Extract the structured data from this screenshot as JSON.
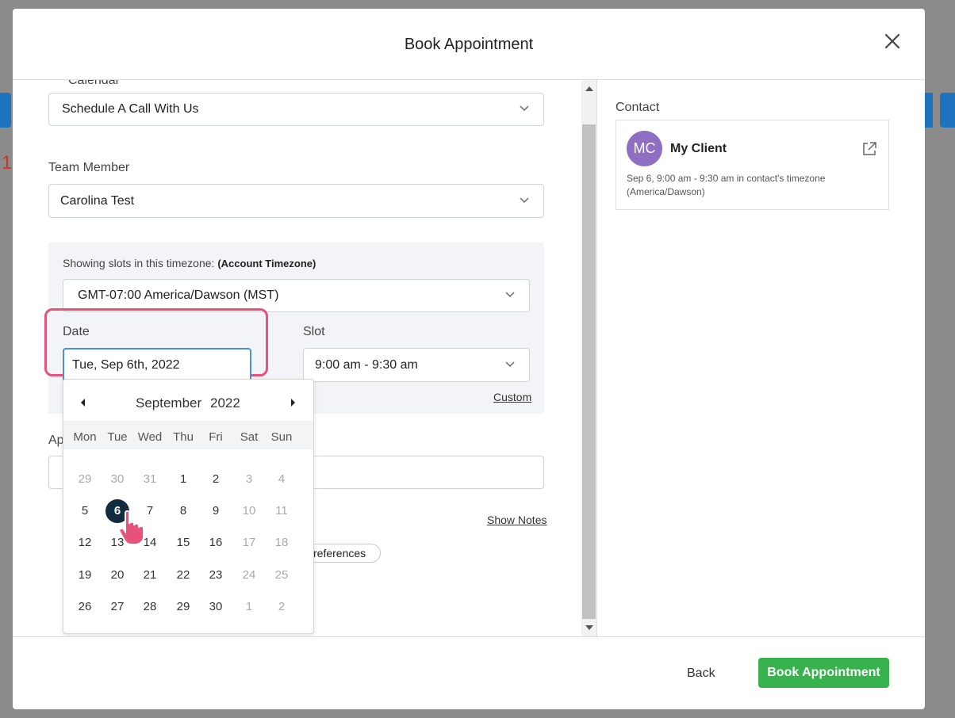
{
  "modal": {
    "title": "Book Appointment"
  },
  "form": {
    "calendar_label": "Calendar",
    "calendar_value": "Schedule A Call With Us",
    "team_member_label": "Team Member",
    "team_member_value": "Carolina Test",
    "timezone_label": "Showing slots in this timezone:",
    "timezone_qualifier": "(Account Timezone)",
    "timezone_value": "GMT-07:00 America/Dawson (MST)",
    "date_label": "Date",
    "date_value": "Tue, Sep 6th, 2022",
    "slot_label": "Slot",
    "slot_value": "9:00 am - 9:30 am",
    "custom_link": "Custom",
    "appointment_label": "Ap",
    "show_notes": "Show Notes",
    "preferences_button": "references"
  },
  "calendar_popup": {
    "month": "September",
    "year": "2022",
    "weekdays": [
      "Mon",
      "Tue",
      "Wed",
      "Thu",
      "Fri",
      "Sat",
      "Sun"
    ],
    "weeks": [
      [
        "29",
        "30",
        "31",
        "1",
        "2",
        "3",
        "4"
      ],
      [
        "5",
        "6",
        "7",
        "8",
        "9",
        "10",
        "11"
      ],
      [
        "12",
        "13",
        "14",
        "15",
        "16",
        "17",
        "18"
      ],
      [
        "19",
        "20",
        "21",
        "22",
        "23",
        "24",
        "25"
      ],
      [
        "26",
        "27",
        "28",
        "29",
        "30",
        "1",
        "2"
      ]
    ],
    "muted": [
      [
        true,
        true,
        true,
        false,
        false,
        true,
        true
      ],
      [
        false,
        false,
        false,
        false,
        false,
        true,
        true
      ],
      [
        false,
        false,
        false,
        false,
        false,
        true,
        true
      ],
      [
        false,
        false,
        false,
        false,
        false,
        true,
        true
      ],
      [
        false,
        false,
        false,
        false,
        false,
        true,
        true
      ]
    ],
    "selected_day": "6"
  },
  "contact": {
    "label": "Contact",
    "initials": "MC",
    "name": "My Client",
    "slot_info": "Sep 6, 9:00 am - 9:30 am in contact's timezone (America/Dawson)"
  },
  "footer": {
    "back_label": "Back",
    "book_label": "Book Appointment"
  },
  "colors": {
    "primary_button": "#37b24d",
    "highlight": "#e8527a",
    "selected_day": "#122b3f",
    "avatar": "#8e6fc2"
  },
  "icons": {
    "close": "close-icon",
    "chevron": "chevron-down-icon",
    "external": "external-link-icon",
    "cursor": "pointer-hand-icon"
  }
}
